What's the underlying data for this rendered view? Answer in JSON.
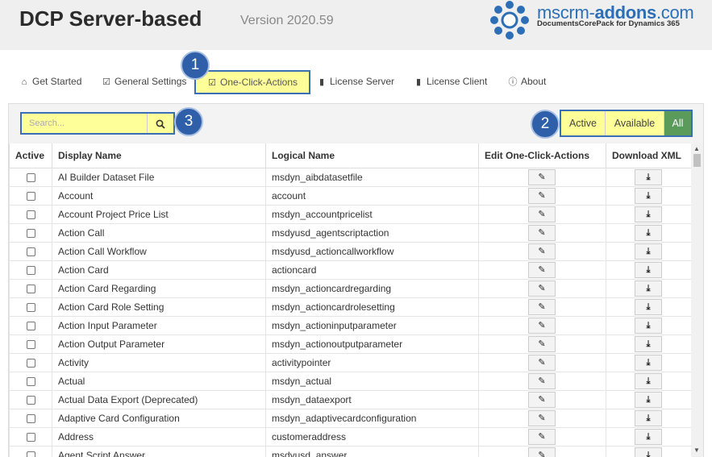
{
  "header": {
    "title": "DCP Server-based",
    "version": "Version 2020.59",
    "logo_text_main": "mscrm-",
    "logo_text_bold": "addons",
    "logo_text_end": ".com",
    "logo_sub": "DocumentsCorePack for Dynamics 365"
  },
  "tabs": [
    {
      "label": "Get Started",
      "icon": "home-icon"
    },
    {
      "label": "General Settings",
      "icon": "checkbox-edit-icon"
    },
    {
      "label": "One-Click-Actions",
      "icon": "checkbox-edit-icon",
      "active": true
    },
    {
      "label": "License Server",
      "icon": "file-icon"
    },
    {
      "label": "License Client",
      "icon": "file-icon"
    },
    {
      "label": "About",
      "icon": "info-icon"
    }
  ],
  "search": {
    "placeholder": "Search..."
  },
  "filters": [
    {
      "label": "Active"
    },
    {
      "label": "Available"
    },
    {
      "label": "All",
      "selected": true
    }
  ],
  "callouts": [
    "1",
    "2",
    "3"
  ],
  "table": {
    "headers": [
      "Active",
      "Display Name",
      "Logical Name",
      "Edit One-Click-Actions",
      "Download XML"
    ],
    "rows": [
      {
        "display": "AI Builder Dataset File",
        "logical": "msdyn_aibdatasetfile"
      },
      {
        "display": "Account",
        "logical": "account"
      },
      {
        "display": "Account Project Price List",
        "logical": "msdyn_accountpricelist"
      },
      {
        "display": "Action Call",
        "logical": "msdyusd_agentscriptaction"
      },
      {
        "display": "Action Call Workflow",
        "logical": "msdyusd_actioncallworkflow"
      },
      {
        "display": "Action Card",
        "logical": "actioncard"
      },
      {
        "display": "Action Card Regarding",
        "logical": "msdyn_actioncardregarding"
      },
      {
        "display": "Action Card Role Setting",
        "logical": "msdyn_actioncardrolesetting"
      },
      {
        "display": "Action Input Parameter",
        "logical": "msdyn_actioninputparameter"
      },
      {
        "display": "Action Output Parameter",
        "logical": "msdyn_actionoutputparameter"
      },
      {
        "display": "Activity",
        "logical": "activitypointer"
      },
      {
        "display": "Actual",
        "logical": "msdyn_actual"
      },
      {
        "display": "Actual Data Export (Deprecated)",
        "logical": "msdyn_dataexport"
      },
      {
        "display": "Adaptive Card Configuration",
        "logical": "msdyn_adaptivecardconfiguration"
      },
      {
        "display": "Address",
        "logical": "customeraddress"
      },
      {
        "display": "Agent Script Answer",
        "logical": "msdyusd_answer"
      }
    ]
  },
  "colors": {
    "highlight": "#ffff99",
    "callout": "#2e5fa8",
    "selected_filter": "#5a9a5a",
    "outline": "#3a6fb5"
  }
}
